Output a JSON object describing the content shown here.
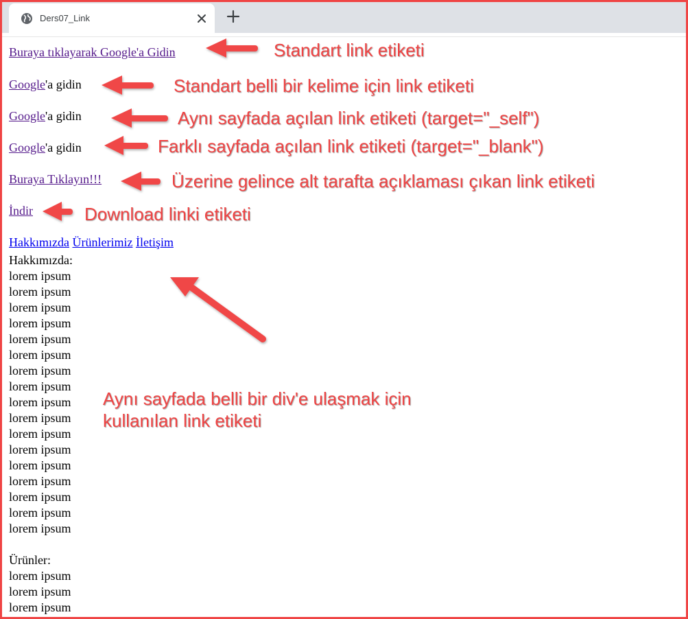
{
  "browser": {
    "tab_title": "Ders07_Link",
    "accent": "#ef4444"
  },
  "page": {
    "link1": "Buraya tıklayarak Google'a Gidin",
    "google_link": "Google",
    "google_suffix": "'a gidin",
    "hover_link": "Buraya Tıklayın!!!",
    "download_link": "İndir",
    "nav": [
      "Hakkımızda",
      "Ürünlerimiz",
      "İletişim"
    ],
    "about_heading": "Hakkımızda:",
    "lorem": "lorem ipsum",
    "products_heading": "Ürünler:"
  },
  "annotations": {
    "a1": "Standart link etiketi",
    "a2": "Standart belli bir kelime için link etiketi",
    "a3": "Aynı sayfada açılan link etiketi (target=\"_self\")",
    "a4": "Farklı sayfada açılan link etiketi (target=\"_blank\")",
    "a5": "Üzerine gelince alt tarafta açıklaması çıkan link etiketi",
    "a6": "Download linki etiketi",
    "a7_line1": "Aynı sayfada belli bir div'e ulaşmak için",
    "a7_line2": "kullanılan link etiketi"
  }
}
